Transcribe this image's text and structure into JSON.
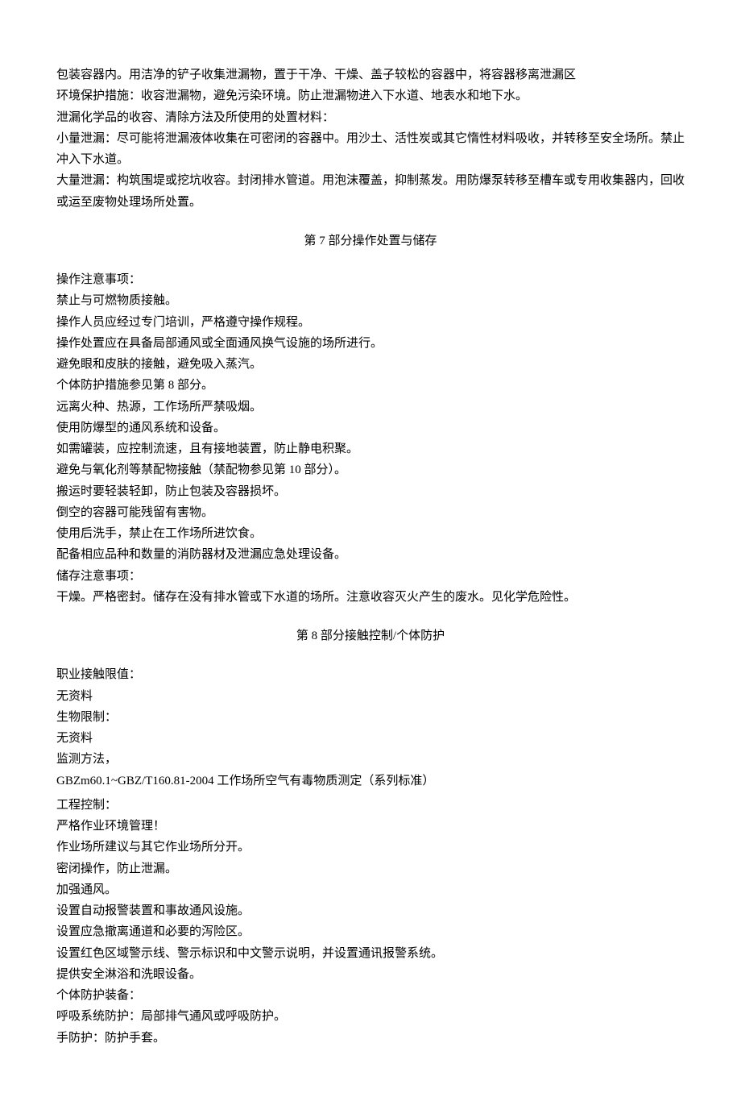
{
  "intro": {
    "p1": "包装容器内。用洁净的铲子收集泄漏物，置于干净、干燥、盖子较松的容器中，将容器移离泄漏区",
    "p2": "环境保护措施：收容泄漏物，避免污染环境。防止泄漏物进入下水道、地表水和地下水。",
    "p3": "泄漏化学品的收容、清除方法及所使用的处置材料：",
    "p4": "小量泄漏：尽可能将泄漏液体收集在可密闭的容器中。用沙土、活性炭或其它惰性材料吸收，并转移至安全场所。禁止冲入下水道。",
    "p5": "大量泄漏：构筑围堤或挖坑收容。封闭排水管道。用泡沫覆盖，抑制蒸发。用防爆泵转移至槽车或专用收集器内，回收或运至废物处理场所处置。"
  },
  "section7": {
    "title": "第 7 部分操作处置与储存",
    "l1": "操作注意事项：",
    "l2": "禁止与可燃物质接触。",
    "l3": "操作人员应经过专门培训，严格遵守操作规程。",
    "l4": "操作处置应在具备局部通风或全面通风换气设施的场所进行。",
    "l5": "避免眼和皮肤的接触，避免吸入蒸汽。",
    "l6": "个体防护措施参见第 8 部分。",
    "l7": "远离火种、热源，工作场所严禁吸烟。",
    "l8": "使用防爆型的通风系统和设备。",
    "l9": "如需罐装，应控制流速，且有接地装置，防止静电积聚。",
    "l10": "避免与氧化剂等禁配物接触（禁配物参见第 10 部分）。",
    "l11": "搬运时要轻装轻卸，防止包装及容器损坏。",
    "l12": "倒空的容器可能残留有害物。",
    "l13": "使用后洗手，禁止在工作场所进饮食。",
    "l14": "配备相应品种和数量的消防器材及泄漏应急处理设备。",
    "l15": "储存注意事项：",
    "l16": "干燥。严格密封。储存在没有排水管或下水道的场所。注意收容灭火产生的废水。见化学危险性。"
  },
  "section8": {
    "title": "第 8 部分接触控制/个体防护",
    "l1": "职业接触限值：",
    "l2": "无资料",
    "l3": "生物限制：",
    "l4": "无资料",
    "l5": "监测方法，",
    "l6": "GBZm60.1~GBZ/T160.81-2004 工作场所空气有毒物质测定（系列标准）",
    "l7": "工程控制：",
    "l8": "严格作业环境管理！",
    "l9": "作业场所建议与其它作业场所分开。",
    "l10": "密闭操作，防止泄漏。",
    "l11": "加强通风。",
    "l12": "设置自动报警装置和事故通风设施。",
    "l13": "设置应急撤离通道和必要的泻险区。",
    "l14": "设置红色区域警示线、警示标识和中文警示说明，并设置通讯报警系统。",
    "l15": "提供安全淋浴和洗眼设备。",
    "l16": "个体防护装备：",
    "l17": "呼吸系统防护：局部排气通风或呼吸防护。",
    "l18": "手防护：防护手套。"
  }
}
